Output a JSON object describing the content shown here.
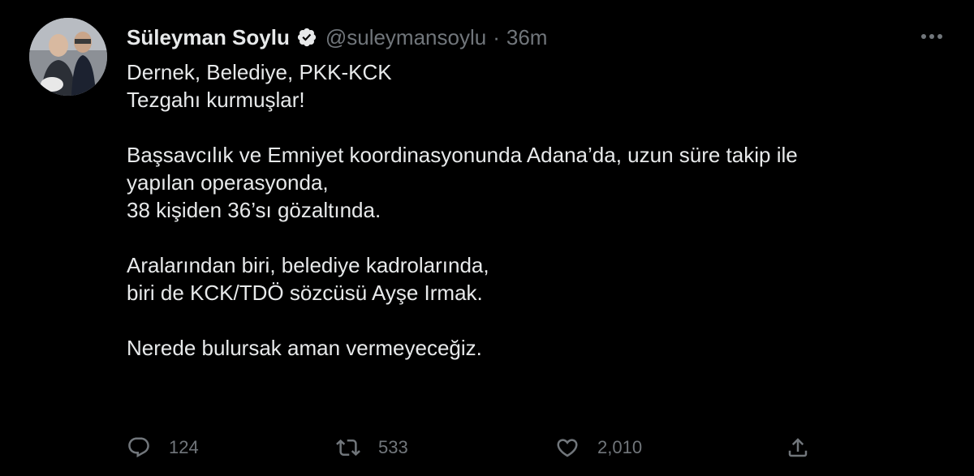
{
  "tweet": {
    "author": {
      "display_name": "Süleyman Soylu",
      "handle": "@suleymansoylu",
      "verified": true
    },
    "separator": "·",
    "time": "36m",
    "text": {
      "line1": "Dernek, Belediye, PKK-KCK",
      "line2": "Tezgahı kurmuşlar!",
      "line3": "Başsavcılık ve Emniyet koordinasyonunda Adana’da, uzun süre takip ile",
      "line4": "yapılan operasyonda,",
      "line5": "38 kişiden 36’sı gözaltında.",
      "line6": "Aralarından biri, belediye kadrolarında,",
      "line7": "biri de KCK/TDÖ sözcüsü Ayşe Irmak.",
      "line8": "Nerede bulursak aman vermeyeceğiz."
    },
    "stats": {
      "replies": "124",
      "retweets": "533",
      "likes": "2,010"
    }
  },
  "icons": {
    "avatar": "avatar-photo",
    "verified": "verified-badge-icon",
    "more": "more-horizontal-icon",
    "reply": "reply-icon",
    "retweet": "retweet-icon",
    "like": "heart-icon",
    "share": "share-icon"
  },
  "colors": {
    "background": "#000000",
    "text_primary": "#e7e9ea",
    "text_secondary": "#71767b"
  }
}
